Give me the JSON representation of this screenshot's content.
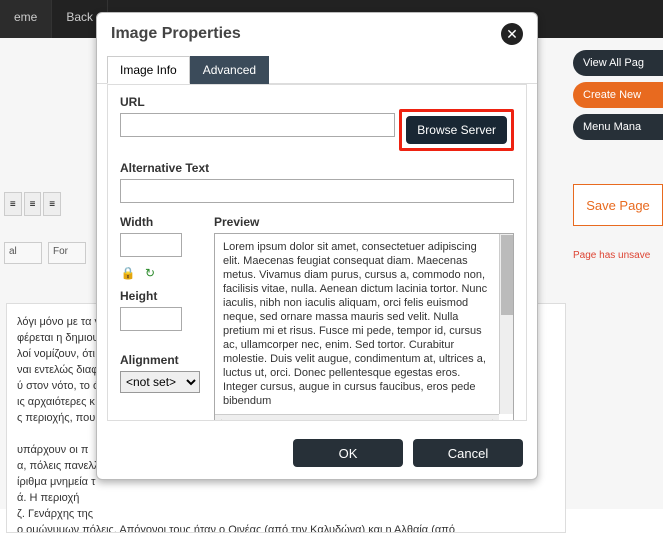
{
  "topbar": {
    "tab1": "eme",
    "tab2": "Back"
  },
  "dialog": {
    "title": "Image Properties",
    "tabs": {
      "info": "Image Info",
      "advanced": "Advanced"
    },
    "url_label": "URL",
    "url_value": "",
    "browse_label": "Browse Server",
    "alt_label": "Alternative Text",
    "alt_value": "",
    "width_label": "Width",
    "width_value": "",
    "height_label": "Height",
    "height_value": "",
    "alignment_label": "Alignment",
    "alignment_value": "<not set>",
    "preview_label": "Preview",
    "preview_text": "Lorem ipsum dolor sit amet, consectetuer adipiscing elit. Maecenas feugiat consequat diam. Maecenas metus. Vivamus diam purus, cursus a, commodo non, facilisis vitae, nulla. Aenean dictum lacinia tortor. Nunc iaculis, nibh non iaculis aliquam, orci felis euismod neque, sed ornare massa mauris sed velit. Nulla pretium mi et risus. Fusce mi pede, tempor id, cursus ac, ullamcorper nec, enim. Sed tortor. Curabitur molestie. Duis velit augue, condimentum at, ultrices a, luctus ut, orci. Donec pellentesque egestas eros. Integer cursus, augue in cursus faucibus, eros pede bibendum",
    "ok": "OK",
    "cancel": "Cancel"
  },
  "right": {
    "view_all": "View All Pag",
    "create_new": "Create New",
    "menu_mana": "Menu Mana",
    "save": "Save Page",
    "unsaved": "Page has unsave"
  },
  "editor": {
    "dd1": "al",
    "dd2": "For",
    "body": "λόγι μόνο με τα γ\nφέρεται η δημιου\nλοί νομίζουν, ότι\nναι εντελώς διαφο\nύ στον νότο, το ό\nις αρχαιότερες κ\nς περιοχής, που\n\nυπάρχουν οι π\nα, πόλεις πανελλ\nίριθμα μνημεία τ\nά. Η περιοχή\nζ. Γενάρχης της\nο ομώνυμων πόλεις. Απόγονοι τους ήταν ο Οινέας (από την Καλυδώνα) και η Αλθαία (από"
  }
}
